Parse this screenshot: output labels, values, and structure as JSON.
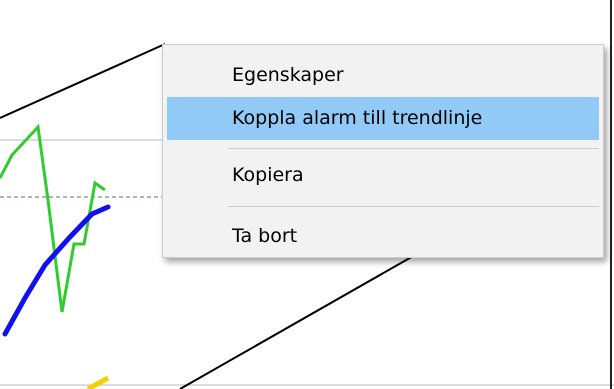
{
  "context_menu": {
    "items": [
      {
        "label": "Egenskaper",
        "highlighted": false
      },
      {
        "label": "Koppla alarm till trendlinje",
        "highlighted": true
      },
      {
        "label": "Kopiera",
        "highlighted": false
      },
      {
        "label": "Ta bort",
        "highlighted": false
      }
    ],
    "highlight_color": "#91c9f7",
    "background_color": "#f2f2f2"
  },
  "chart": {
    "series_colors": {
      "green_line": "#2ecc2e",
      "blue_line": "#1010f0",
      "yellow_line": "#f5d000",
      "trend_lines": "#000000",
      "dashed_reference": "#4a7a6a"
    }
  }
}
